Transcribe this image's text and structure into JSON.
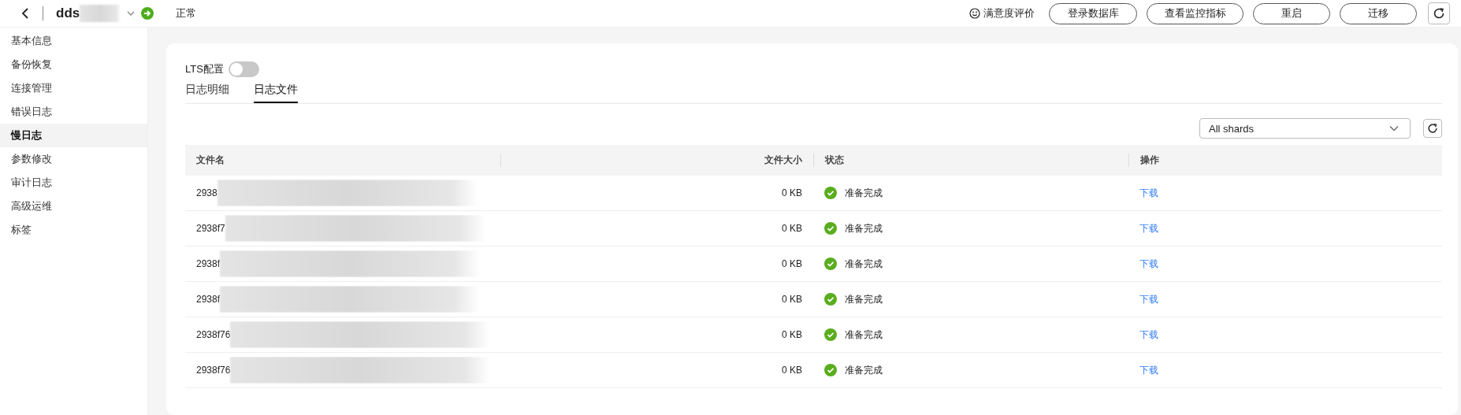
{
  "header": {
    "title": "dds",
    "status": "正常",
    "feedback": "满意度评价",
    "buttons": [
      "登录数据库",
      "查看监控指标",
      "重启",
      "迁移"
    ]
  },
  "sidebar": {
    "items": [
      {
        "label": "基本信息",
        "selected": false
      },
      {
        "label": "备份恢复",
        "selected": false
      },
      {
        "label": "连接管理",
        "selected": false
      },
      {
        "label": "错误日志",
        "selected": false
      },
      {
        "label": "慢日志",
        "selected": true
      },
      {
        "label": "参数修改",
        "selected": false
      },
      {
        "label": "审计日志",
        "selected": false
      },
      {
        "label": "高级运维",
        "selected": false
      },
      {
        "label": "标签",
        "selected": false
      }
    ]
  },
  "lts": {
    "label": "LTS配置",
    "on": false
  },
  "tabs": [
    {
      "label": "日志明细",
      "selected": false
    },
    {
      "label": "日志文件",
      "selected": true
    }
  ],
  "shard_select": {
    "value": "All shards"
  },
  "table": {
    "columns": [
      "文件名",
      "文件大小",
      "状态",
      "操作"
    ],
    "rows": [
      {
        "name": "2938",
        "size": "0 KB",
        "status": "准备完成",
        "action": "下载"
      },
      {
        "name": "2938f7",
        "size": "0 KB",
        "status": "准备完成",
        "action": "下载"
      },
      {
        "name": "2938f",
        "size": "0 KB",
        "status": "准备完成",
        "action": "下载"
      },
      {
        "name": "2938f",
        "size": "0 KB",
        "status": "准备完成",
        "action": "下载"
      },
      {
        "name": "2938f76",
        "size": "0 KB",
        "status": "准备完成",
        "action": "下载"
      },
      {
        "name": "2938f76",
        "size": "0 KB",
        "status": "准备完成",
        "action": "下载"
      }
    ]
  }
}
